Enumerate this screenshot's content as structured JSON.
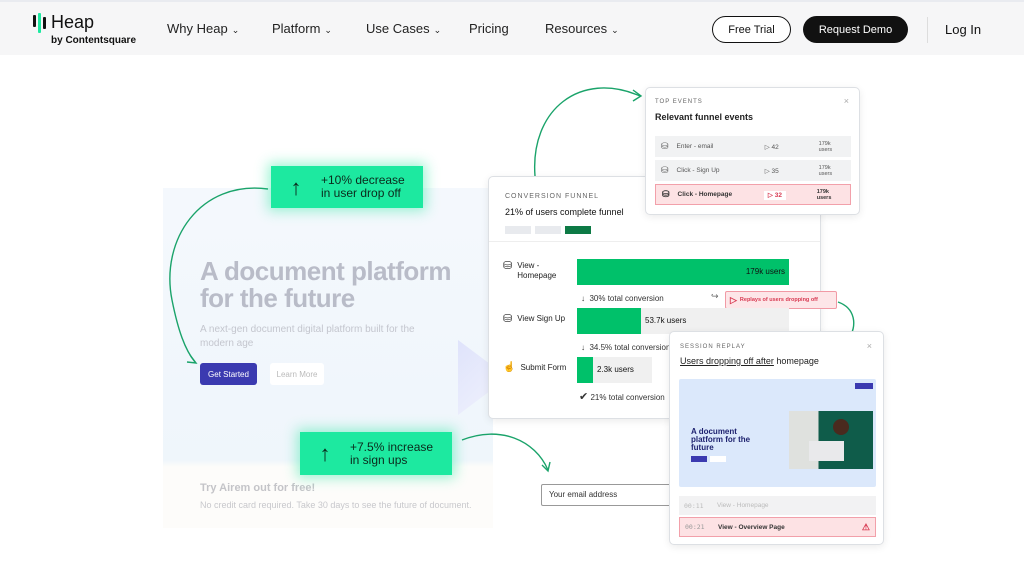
{
  "nav": {
    "brand": "Heap",
    "brand_sub": "by Contentsquare",
    "items": [
      {
        "label": "Why Heap",
        "dropdown": true
      },
      {
        "label": "Platform",
        "dropdown": true
      },
      {
        "label": "Use Cases",
        "dropdown": true
      },
      {
        "label": "Pricing",
        "dropdown": false
      },
      {
        "label": "Resources",
        "dropdown": true
      }
    ],
    "free_trial": "Free Trial",
    "request_demo": "Request Demo",
    "login": "Log In"
  },
  "hero": {
    "title_line1": "A document platform",
    "title_line2": "for the future",
    "subtitle": "A next-gen document digital platform built for the modern age",
    "get_started": "Get Started",
    "learn_more": "Learn More",
    "try_title": "Try Airem out for free!",
    "try_sub": "No credit card required. Take 30 days to see the future of document.",
    "email_placeholder": "Your email address"
  },
  "badges": [
    {
      "line1": "+10% decrease",
      "line2": "in user drop off"
    },
    {
      "line1": "+7.5% increase",
      "line2": "in sign ups"
    }
  ],
  "top_events": {
    "caption": "TOP EVENTS",
    "title": "Relevant funnel events",
    "rows": [
      {
        "name": "Enter - email",
        "replays": "42",
        "users": "179k users"
      },
      {
        "name": "Click - Sign Up",
        "replays": "35",
        "users": "179k users"
      },
      {
        "name": "Click - Homepage",
        "replays": "32",
        "users": "179k users",
        "highlight": true
      }
    ]
  },
  "funnel": {
    "caption": "CONVERSION FUNNEL",
    "title": "21% of users complete funnel",
    "steps": [
      {
        "label": "View - Homepage",
        "users": "179k users",
        "fraction": 1.0
      },
      {
        "label": "View Sign Up",
        "users": "53.7k users",
        "fraction": 0.3
      },
      {
        "label": "Submit Form",
        "users": "2.3k users",
        "fraction": 0.075
      }
    ],
    "conv1": "30% total conversion",
    "conv2": "34.5% total conversion",
    "conv3": "21% total conversion",
    "replays_label": "Replays of users dropping off"
  },
  "session": {
    "caption": "SESSION REPLAY",
    "title_underlined": "Users dropping off after",
    "title_rest": " homepage",
    "preview_title": "A document platform for the future",
    "rows": [
      {
        "time": "00:11",
        "label": "View - Homepage"
      },
      {
        "time": "00:21",
        "label": "View - Overview Page",
        "alert": true
      }
    ]
  },
  "colors": {
    "green": "#00c16a",
    "badge": "#1de9a0",
    "alert": "#fde2e4",
    "accent": "#3b3ab0"
  }
}
